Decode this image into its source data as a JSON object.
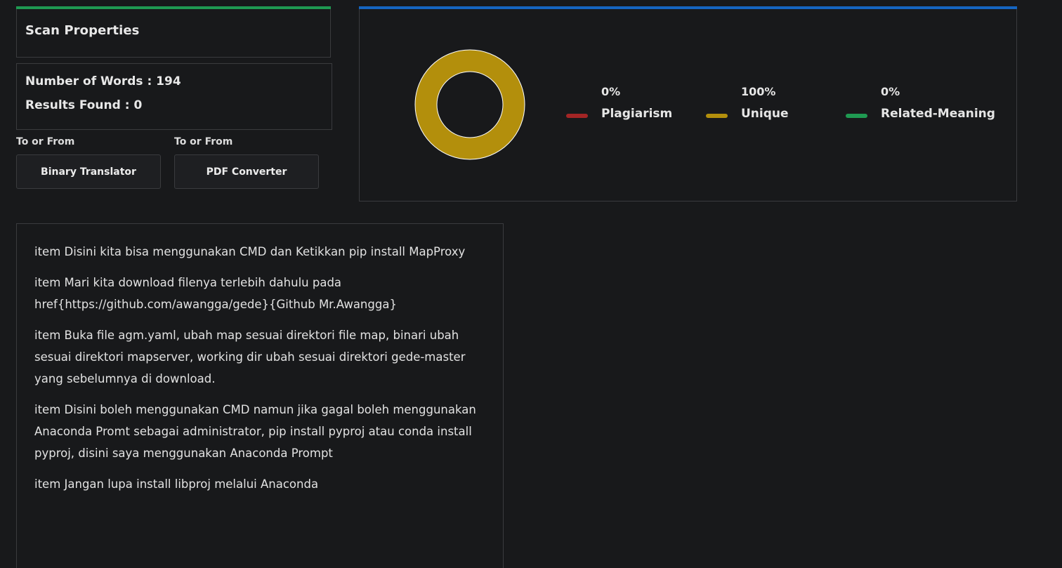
{
  "colors": {
    "green": "#1f9a52",
    "blue": "#1565c0",
    "plagiarism": "#a32525",
    "unique": "#b38f0c",
    "related": "#1f9a52",
    "border": "#3a3b3e"
  },
  "scan_properties": {
    "title": "Scan Properties",
    "words_line": "Number of Words : 194",
    "results_line": "Results Found : 0"
  },
  "tools": [
    {
      "label": "To or From",
      "button": "Binary Translator"
    },
    {
      "label": "To or From",
      "button": "PDF Converter"
    }
  ],
  "legend": [
    {
      "percent": "0%",
      "name": "Plagiarism",
      "color_key": "plagiarism"
    },
    {
      "percent": "100%",
      "name": "Unique",
      "color_key": "unique"
    },
    {
      "percent": "0%",
      "name": "Related-Meaning",
      "color_key": "related"
    }
  ],
  "chart_data": {
    "type": "pie",
    "categories": [
      "Plagiarism",
      "Unique",
      "Related-Meaning"
    ],
    "values": [
      0,
      100,
      0
    ],
    "title": ""
  },
  "content": {
    "paragraphs": [
      "item Disini kita bisa menggunakan CMD dan Ketikkan pip install MapProxy",
      "item Mari kita download filenya terlebih dahulu pada href{https://github.com/awangga/gede}{Github Mr.Awangga}",
      "item Buka file agm.yaml, ubah map sesuai direktori file map, binari ubah sesuai direktori mapserver, working dir ubah sesuai direktori gede-master yang sebelumnya di download.",
      "item Disini boleh menggunakan CMD namun jika gagal boleh menggunakan Anaconda Promt sebagai administrator, pip install pyproj atau conda install pyproj, disini saya menggunakan Anaconda Prompt",
      "item Jangan lupa install libproj melalui Anaconda"
    ]
  }
}
